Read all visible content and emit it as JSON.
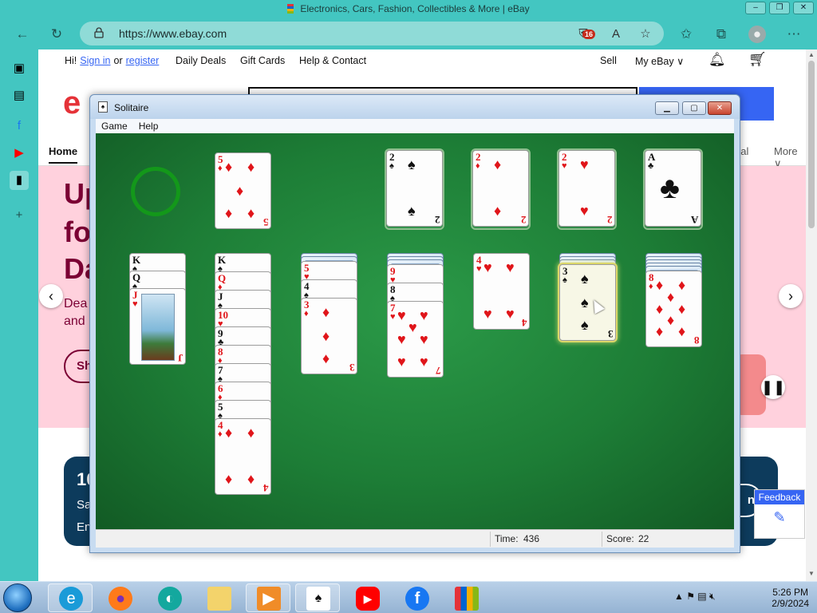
{
  "browser": {
    "title": "Electronics, Cars, Fashion, Collectibles & More | eBay",
    "url": "https://www.ebay.com",
    "tracker_badge": "16",
    "window_buttons": [
      "–",
      "❐",
      "✕"
    ]
  },
  "ebay": {
    "greeting": "Hi!",
    "sign_in": "Sign in",
    "or": "or",
    "register": "register",
    "nav_links": [
      "Daily Deals",
      "Gift Cards",
      "Help & Contact"
    ],
    "sell": "Sell",
    "my_ebay": "My eBay ∨",
    "logo_partial": "e",
    "home_tab": "Home",
    "tab_right_partial": "rial",
    "more": "More ∨",
    "hero_lines": [
      "Up",
      "fo",
      "Da"
    ],
    "hero_small": [
      "Dea",
      "and"
    ],
    "hero_btn": "Sh",
    "promo_partial": [
      "10",
      "Sa",
      "En"
    ],
    "promo_right": "n",
    "feedback": "Feedback"
  },
  "solitaire": {
    "window_title": "Solitaire",
    "menu": [
      "Game",
      "Help"
    ],
    "time_label": "Time:",
    "time_value": "436",
    "score_label": "Score:",
    "score_value": "22",
    "waste": {
      "rank": "5",
      "suit": "♦",
      "color": "red"
    },
    "foundations": [
      {
        "rank": "2",
        "suit": "♠",
        "color": "black"
      },
      {
        "rank": "2",
        "suit": "♦",
        "color": "red"
      },
      {
        "rank": "2",
        "suit": "♥",
        "color": "red"
      },
      {
        "rank": "A",
        "suit": "♣",
        "color": "black"
      }
    ],
    "col1": [
      {
        "rank": "K",
        "suit": "♠"
      },
      {
        "rank": "Q",
        "suit": "♠"
      },
      {
        "rank": "J",
        "suit": "♥"
      }
    ],
    "col2": [
      {
        "rank": "K",
        "suit": "♠"
      },
      {
        "rank": "Q",
        "suit": "♦"
      },
      {
        "rank": "J",
        "suit": "♠"
      },
      {
        "rank": "10",
        "suit": "♥"
      },
      {
        "rank": "9",
        "suit": "♣"
      },
      {
        "rank": "8",
        "suit": "♦"
      },
      {
        "rank": "7",
        "suit": "♠"
      },
      {
        "rank": "6",
        "suit": "♦"
      },
      {
        "rank": "5",
        "suit": "♠"
      },
      {
        "rank": "4",
        "suit": "♦"
      }
    ],
    "col3": [
      {
        "rank": "5",
        "suit": "♥"
      },
      {
        "rank": "4",
        "suit": "♠"
      },
      {
        "rank": "3",
        "suit": "♦"
      }
    ],
    "col4": [
      {
        "rank": "9",
        "suit": "♥"
      },
      {
        "rank": "8",
        "suit": "♠"
      },
      {
        "rank": "7",
        "suit": "♥"
      }
    ],
    "col5": [
      {
        "rank": "4",
        "suit": "♥"
      }
    ],
    "col6": [
      {
        "rank": "3",
        "suit": "♠"
      }
    ],
    "col7": [
      {
        "rank": "8",
        "suit": "♦"
      }
    ]
  },
  "taskbar": {
    "time": "5:26 PM",
    "date": "2/9/2024"
  }
}
